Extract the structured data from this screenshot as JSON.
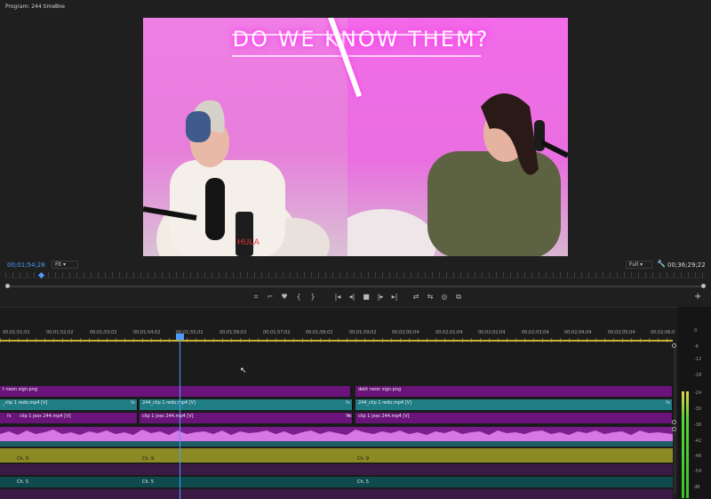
{
  "monitor": {
    "title": "Program: 244 timeline",
    "menu_icon": "≡",
    "timecode_left": "00;01;54;28",
    "fit_value": "Fit",
    "full_value": "Full",
    "timecode_right": "00;36;29;22",
    "neon_text": "DO WE KNOW THEM?",
    "transport_icons": [
      "⌗",
      "⌐",
      "♥",
      "{",
      "}",
      "|◂",
      "◂|",
      "■",
      "|▸",
      "▸|",
      "⇄",
      "⇆",
      "◎",
      "⧉"
    ],
    "add_icon": "+"
  },
  "timeline": {
    "ruler_labels": [
      "00;01;51;02",
      "00;01;52;02",
      "00;01;53;02",
      "00;01;54;02",
      "00;01;55;02",
      "00;01;56;02",
      "00;01;57;02",
      "00;01;58;02",
      "00;01;59;02",
      "00;02;00;04",
      "00;02;01;04",
      "00;02;02;04",
      "00;02;03;04",
      "00;02;04;04",
      "00;02;05;04",
      "00;02;06;0"
    ],
    "tracks": {
      "v3": [
        {
          "label": "t neon sign.png"
        },
        {
          "label": "dekt neon sign.png"
        }
      ],
      "v2": [
        {
          "label": "_clip 1 redo.mp4 [V]",
          "fx": "fx"
        },
        {
          "label": "244_clip 1 redo.mp4 [V]",
          "fx": "fx"
        },
        {
          "label": "244_clip 1 redo.mp4 [V]",
          "fx": "fx"
        }
      ],
      "v1": [
        {
          "label": "clip 1 jess 244.mp4 [V]",
          "fx": "fx"
        },
        {
          "label": "clip 1 jess 244.mp4 [V]",
          "fx": "fx"
        },
        {
          "label": "clip 1 jess 244.mp4 [V]",
          "fx": "fx"
        }
      ],
      "a1_channel": "Ch. 9",
      "a2_channel": "Ch. 5"
    },
    "meter_labels": [
      "0",
      "-6",
      "-12",
      "-18",
      "-24",
      "-30",
      "-36",
      "-42",
      "-48",
      "-54",
      "dB"
    ]
  },
  "colors": {
    "accent": "#4d9bff",
    "video_purple": "#6a137a",
    "video_teal": "#1f7d86",
    "audio_pink": "#c55ed6",
    "audio_olive": "#8c8a25"
  }
}
